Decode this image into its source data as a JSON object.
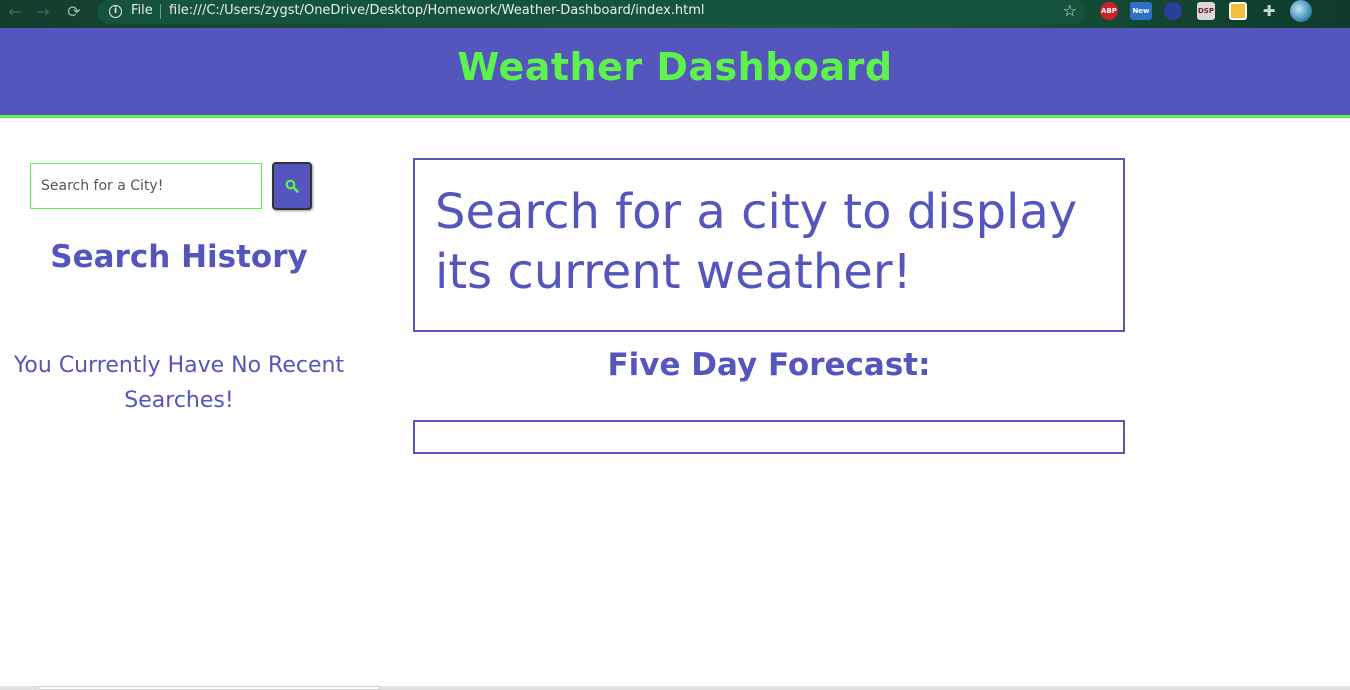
{
  "browser": {
    "nav": {
      "back": "←",
      "forward": "→",
      "reload": "⟳"
    },
    "info_glyph": "i",
    "scheme": "File",
    "url": "file:///C:/Users/zygst/OneDrive/Desktop/Homework/Weather-Dashboard/index.html",
    "star": "☆",
    "extensions": {
      "abp": "ABP",
      "new_badge": "New",
      "dsp": "DSP"
    }
  },
  "header": {
    "title": "Weather Dashboard"
  },
  "sidebar": {
    "search_placeholder": "Search for a City!",
    "history_title": "Search History",
    "no_recent_text": "You Currently Have No Recent Searches!"
  },
  "main": {
    "current_prompt": "Search for a city to display its current weather!",
    "forecast_title": "Five Day Forecast:"
  },
  "colors": {
    "brand": "#5455bd",
    "accent": "#5ef24c"
  }
}
